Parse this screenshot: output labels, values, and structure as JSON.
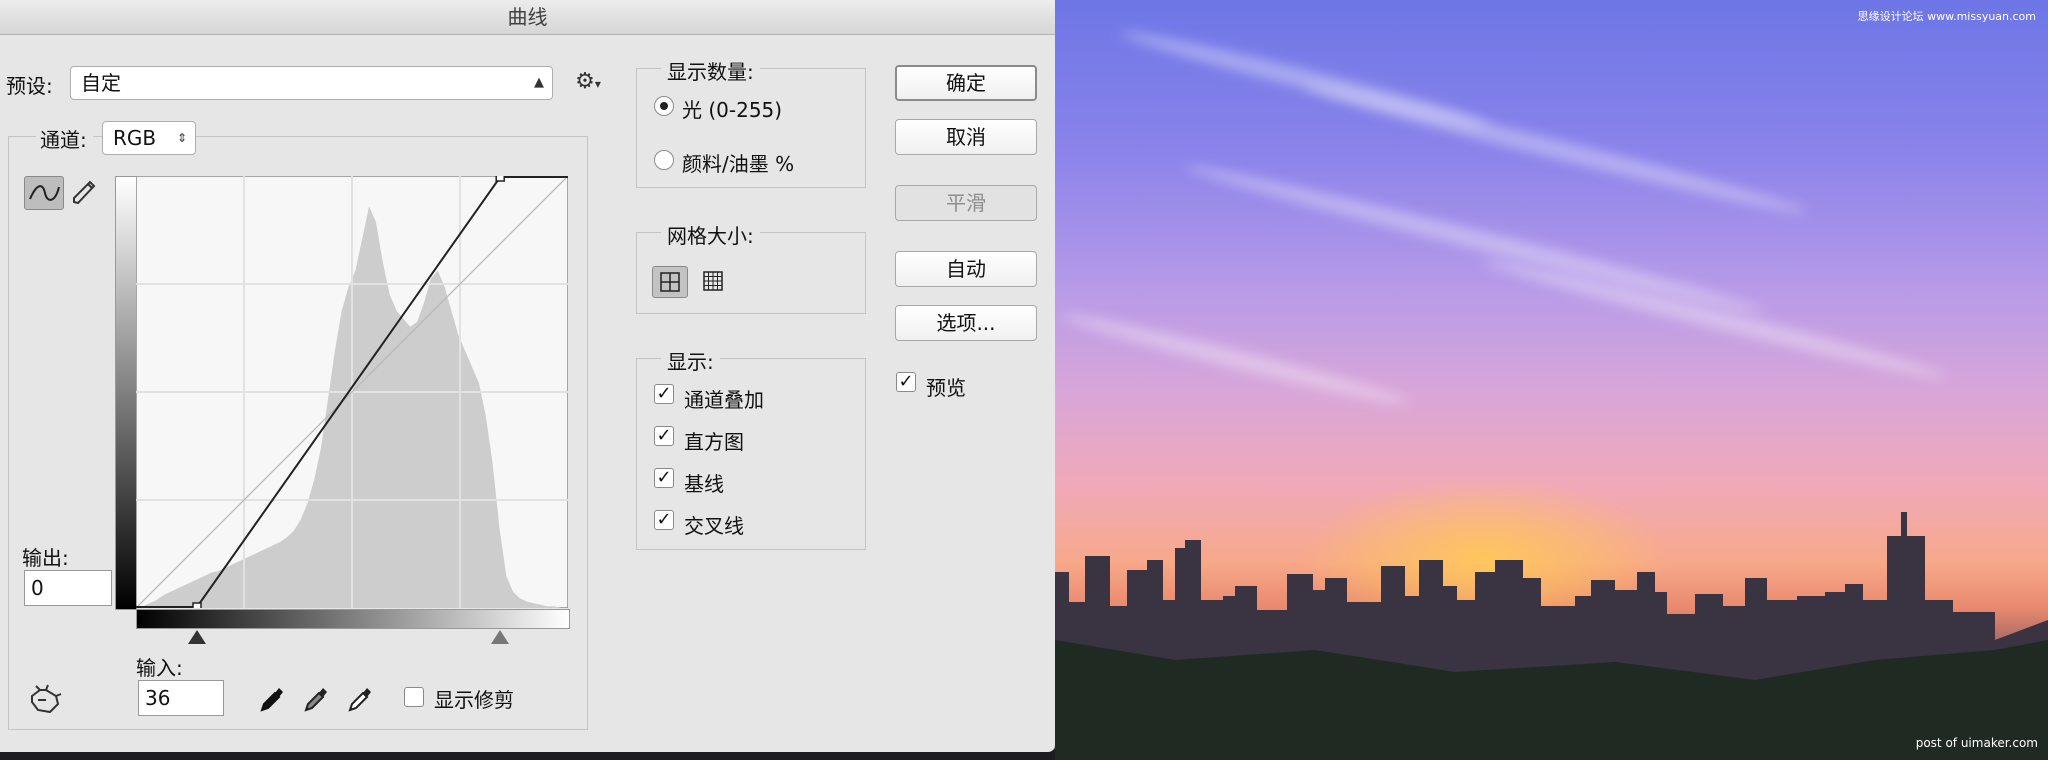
{
  "dialog": {
    "title": "曲线"
  },
  "preset": {
    "label": "预设:",
    "value": "自定"
  },
  "channel": {
    "label": "通道:",
    "value": "RGB"
  },
  "output": {
    "label": "输出:",
    "value": "0"
  },
  "input": {
    "label": "输入:",
    "value": "36"
  },
  "show_clipping_label": "显示修剪",
  "display_amount": {
    "title": "显示数量:",
    "options": [
      {
        "label": "光 (0-255)",
        "selected": true
      },
      {
        "label": "颜料/油墨 %",
        "selected": false
      }
    ]
  },
  "grid_size": {
    "title": "网格大小:"
  },
  "display": {
    "title": "显示:",
    "options": [
      {
        "label": "通道叠加",
        "checked": true
      },
      {
        "label": "直方图",
        "checked": true
      },
      {
        "label": "基线",
        "checked": true
      },
      {
        "label": "交叉线",
        "checked": true
      }
    ]
  },
  "buttons": {
    "ok": "确定",
    "cancel": "取消",
    "smooth": "平滑",
    "auto": "自动",
    "options": "选项..."
  },
  "preview": {
    "label": "预览",
    "checked": true
  },
  "curve": {
    "black_input": 36,
    "white_input": 215,
    "histogram": [
      0,
      1,
      3,
      5,
      8,
      10,
      12,
      14,
      16,
      18,
      20,
      22,
      23,
      25,
      27,
      29,
      31,
      33,
      35,
      37,
      39,
      41,
      44,
      48,
      55,
      65,
      80,
      100,
      130,
      160,
      185,
      200,
      210,
      230,
      250,
      240,
      215,
      195,
      185,
      180,
      175,
      178,
      190,
      205,
      210,
      200,
      185,
      170,
      160,
      150,
      140,
      120,
      90,
      50,
      20,
      10,
      6,
      4,
      3,
      2,
      1,
      1,
      0,
      0
    ]
  },
  "photo_credits": {
    "top": "思缘设计论坛 www.missyuan.com",
    "bottom": "post of uimaker.com"
  }
}
